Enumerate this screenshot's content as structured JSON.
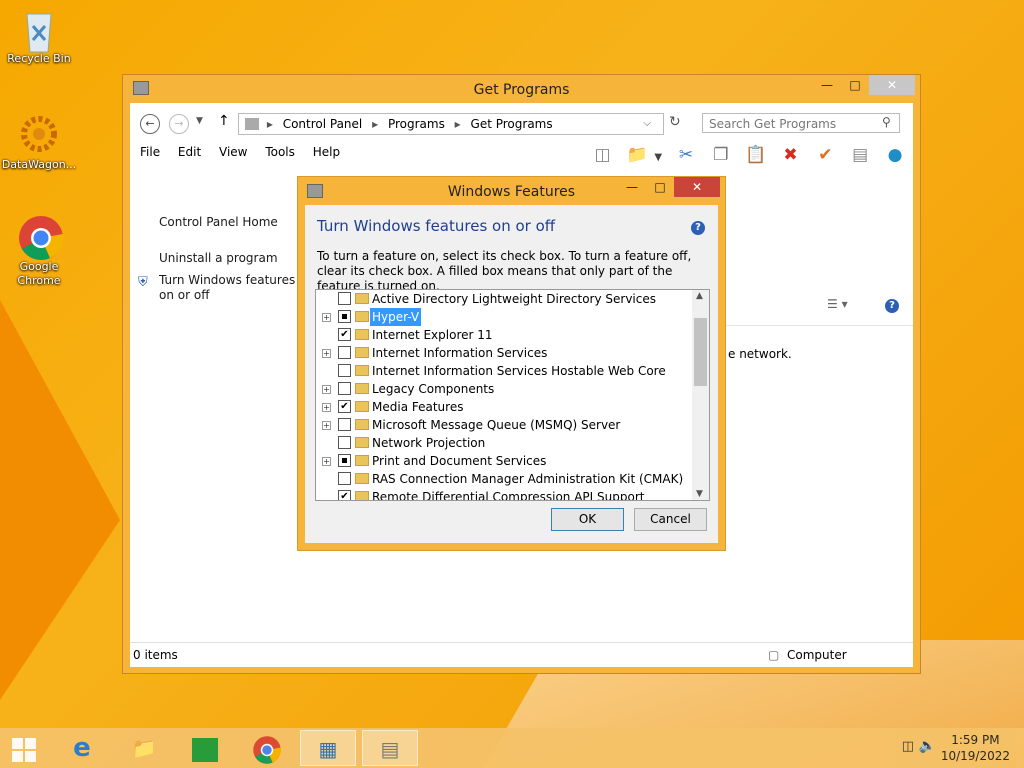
{
  "desktop": {
    "icons": [
      {
        "label": "Recycle Bin"
      },
      {
        "label": "DataWagon..."
      },
      {
        "label": "Google Chrome"
      }
    ]
  },
  "main_window": {
    "title": "Get Programs",
    "address": [
      "Control Panel",
      "Programs",
      "Get Programs"
    ],
    "search_placeholder": "Search Get Programs",
    "menu": [
      "File",
      "Edit",
      "View",
      "Tools",
      "Help"
    ],
    "left_links": [
      "Control Panel Home",
      "Uninstall a program",
      "Turn Windows features on or off"
    ],
    "content_fragment": "e network.",
    "status_left": "0 items",
    "status_right": "Computer"
  },
  "dialog": {
    "title": "Windows Features",
    "heading": "Turn Windows features on or off",
    "description": "To turn a feature on, select its check box. To turn a feature off, clear its check box. A filled box means that only part of the feature is turned on.",
    "features": [
      {
        "label": "Active Directory Lightweight Directory Services",
        "expandable": false,
        "state": "unchecked"
      },
      {
        "label": "Hyper-V",
        "expandable": true,
        "state": "partial",
        "selected": true
      },
      {
        "label": "Internet Explorer 11",
        "expandable": false,
        "state": "checked"
      },
      {
        "label": "Internet Information Services",
        "expandable": true,
        "state": "unchecked"
      },
      {
        "label": "Internet Information Services Hostable Web Core",
        "expandable": false,
        "state": "unchecked"
      },
      {
        "label": "Legacy Components",
        "expandable": true,
        "state": "unchecked"
      },
      {
        "label": "Media Features",
        "expandable": true,
        "state": "checked"
      },
      {
        "label": "Microsoft Message Queue (MSMQ) Server",
        "expandable": true,
        "state": "unchecked"
      },
      {
        "label": "Network Projection",
        "expandable": false,
        "state": "unchecked"
      },
      {
        "label": "Print and Document Services",
        "expandable": true,
        "state": "partial"
      },
      {
        "label": "RAS Connection Manager Administration Kit (CMAK)",
        "expandable": false,
        "state": "unchecked"
      },
      {
        "label": "Remote Differential Compression API Support",
        "expandable": false,
        "state": "checked"
      }
    ],
    "ok_label": "OK",
    "cancel_label": "Cancel"
  },
  "taskbar": {
    "time": "1:59 PM",
    "date": "10/19/2022"
  }
}
